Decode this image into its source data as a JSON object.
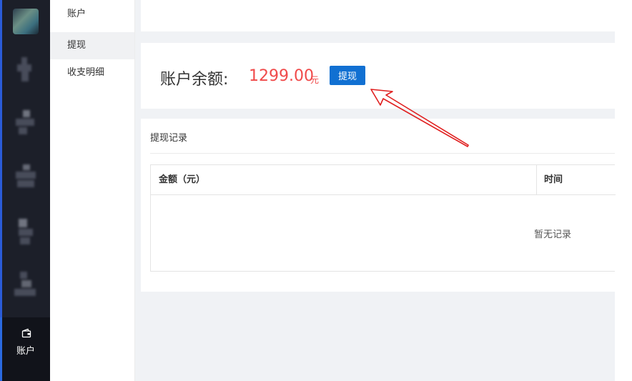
{
  "nav_rail": {
    "active_item": {
      "label": "账户",
      "icon": "wallet-icon"
    }
  },
  "submenu": {
    "items": [
      {
        "label": "账户"
      },
      {
        "label": "提现"
      },
      {
        "label": "收支明细"
      }
    ],
    "active": "提现"
  },
  "balance": {
    "label": "账户余额:",
    "amount": "1299.00",
    "unit": "元",
    "withdraw_button": "提现"
  },
  "records": {
    "title": "提现记录",
    "columns": [
      "金额（元）",
      "时间"
    ],
    "rows": [],
    "empty_text": "暂无记录"
  },
  "colors": {
    "accent": "#1170d2",
    "amount": "#f04a4a",
    "rail": "#1c1f29",
    "annotation": "#e02020"
  }
}
